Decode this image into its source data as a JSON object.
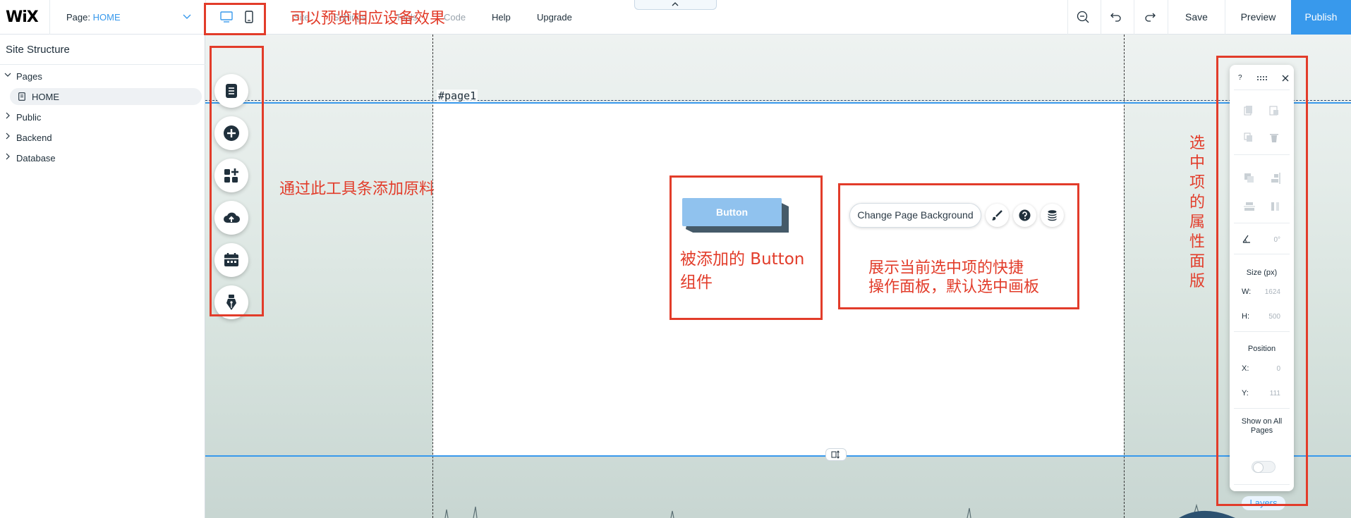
{
  "topbar": {
    "logo": "WiX",
    "page_label": "Page:",
    "page_value": "HOME",
    "menu": [
      {
        "label": "Site",
        "name": "menu-site"
      },
      {
        "label": "Settings",
        "name": "menu-settings"
      },
      {
        "label": "Tools",
        "name": "menu-tools"
      },
      {
        "label": "Code",
        "name": "menu-code"
      },
      {
        "label": "Help",
        "name": "menu-help"
      },
      {
        "label": "Upgrade",
        "name": "menu-upgrade"
      }
    ],
    "save": "Save",
    "preview": "Preview",
    "publish": "Publish"
  },
  "sidebar": {
    "title": "Site Structure",
    "items": [
      {
        "label": "Pages",
        "expanded": true
      },
      {
        "label": "HOME"
      },
      {
        "label": "Public",
        "expanded": false
      },
      {
        "label": "Backend",
        "expanded": false
      },
      {
        "label": "Database",
        "expanded": false
      }
    ]
  },
  "canvas": {
    "page_tag": "#page1",
    "button_label": "Button",
    "quick_action": "Change Page Background"
  },
  "properties": {
    "size_title": "Size (px)",
    "w_label": "W:",
    "w_value": "1624",
    "h_label": "H:",
    "h_value": "500",
    "position_title": "Position",
    "x_label": "X:",
    "x_value": "0",
    "y_label": "Y:",
    "y_value": "111",
    "rotation": "0°",
    "show_all_pages": "Show on All Pages",
    "layers": "Layers",
    "help": "?"
  },
  "annotations": {
    "devices": "可以预览相应设备效果",
    "toolbar": "通过此工具条添加原料",
    "button_line1": "被添加的 Button",
    "button_line2": "组件",
    "quick_line1": "展示当前选中项的快捷",
    "quick_line2": "操作面板，默认选中画板",
    "props_vertical": "选中项的属性面版"
  },
  "colors": {
    "accent": "#3899ec",
    "annotation": "#e23c2a",
    "button_face": "#90c2ee",
    "button_shadow": "#455a69"
  }
}
